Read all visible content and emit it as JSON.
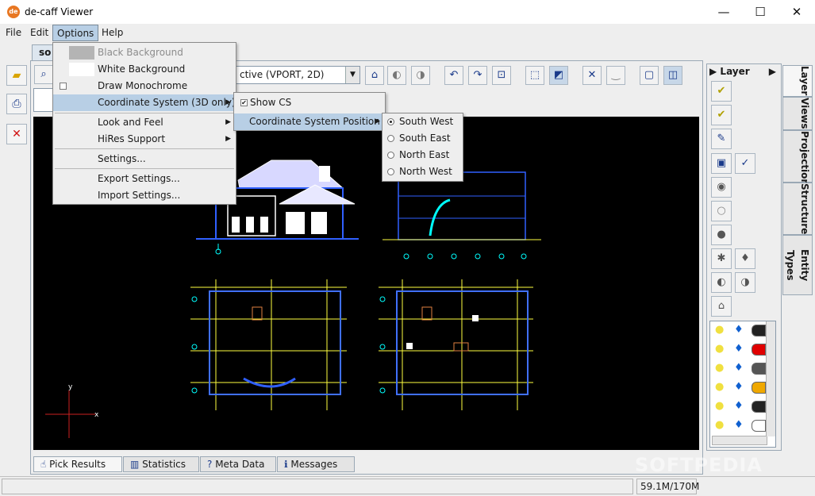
{
  "window": {
    "app_icon_text": "de",
    "title": "de-caff Viewer",
    "minimize_glyph": "—",
    "maximize_glyph": "☐",
    "close_glyph": "✕"
  },
  "menubar": {
    "file": "File",
    "edit": "Edit",
    "options": "Options",
    "help": "Help"
  },
  "document_tab": "so",
  "toolbar": {
    "viewport_value": "ctive (VPORT, 2D)"
  },
  "options_menu": {
    "items": [
      {
        "label": "Black Background",
        "disabled": true,
        "swatch": "#b4b4b4"
      },
      {
        "label": "White Background",
        "disabled": false,
        "swatch": "#ffffff"
      },
      {
        "label": "Draw Monochrome",
        "checkbox": true,
        "checked": false
      },
      {
        "label": "Coordinate System (3D only)",
        "submenu": true,
        "highlighted": true
      },
      {
        "label": "Look and Feel",
        "submenu": true
      },
      {
        "label": "HiRes Support",
        "submenu": true
      },
      {
        "label": "Settings..."
      },
      {
        "label": "Export Settings..."
      },
      {
        "label": "Import Settings..."
      }
    ]
  },
  "cs_submenu": {
    "show_cs": "Show CS",
    "show_cs_checked": true,
    "position": "Coordinate System Position"
  },
  "position_submenu": {
    "options": [
      "South West",
      "South East",
      "North East",
      "North West"
    ],
    "selected": "South West"
  },
  "canvas": {
    "axis_x": "x",
    "axis_y": "y",
    "background": "#000000"
  },
  "bottom_tabs": [
    "Pick Results",
    "Statistics",
    "Meta Data",
    "Messages"
  ],
  "status": {
    "memory": "59.1M/170M"
  },
  "layer_panel": {
    "header": "Layer",
    "side_tabs": [
      "Layer",
      "Views",
      "Projection",
      "Structure",
      "Entity Types"
    ]
  },
  "layer_rows": [
    {
      "color": "#222222"
    },
    {
      "color": "#e00000"
    },
    {
      "color": "#555555"
    },
    {
      "color": "#f0a800"
    },
    {
      "color": "#222222"
    },
    {
      "color": "#ffffff"
    }
  ],
  "watermark": "SOFTPEDIA"
}
